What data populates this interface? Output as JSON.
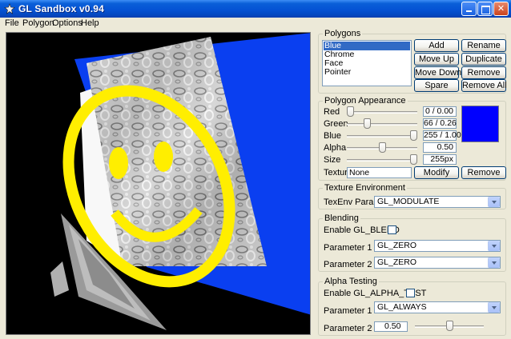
{
  "window": {
    "title": "GL Sandbox v0.94",
    "controls": {
      "minimize": "",
      "maximize": "",
      "close": "✕"
    }
  },
  "menu": [
    "File",
    "Polygon",
    "Options",
    "Help"
  ],
  "polygons": {
    "title": "Polygons",
    "items": [
      "Blue",
      "Chrome",
      "Face",
      "Pointer"
    ],
    "selected": "Blue",
    "buttons": {
      "add": "Add",
      "rename": "Rename",
      "move_up": "Move Up",
      "duplicate": "Duplicate",
      "move_down": "Move Down",
      "remove": "Remove",
      "spare": "Spare",
      "remove_all": "Remove All"
    }
  },
  "appearance": {
    "title": "Polygon Appearance",
    "red": {
      "label": "Red",
      "value": "0 / 0.00",
      "level": 0.0
    },
    "green": {
      "label": "Green",
      "value": "66 / 0.26",
      "level": 0.26
    },
    "blue": {
      "label": "Blue",
      "value": "255 / 1.00",
      "level": 1.0
    },
    "alpha": {
      "label": "Alpha",
      "value": "0.50",
      "level": 0.5
    },
    "size": {
      "label": "Size",
      "value": "255px",
      "level": 1.0
    },
    "swatch_color": "#0000ff",
    "texture": {
      "label": "Texture",
      "value": "None",
      "modify": "Modify",
      "remove": "Remove"
    }
  },
  "texenv": {
    "title": "Texture Environment",
    "param_label": "TexEnv Param",
    "param_value": "GL_MODULATE"
  },
  "blending": {
    "title": "Blending",
    "enable_label": "Enable GL_BLEND",
    "enabled": false,
    "param1_label": "Parameter 1",
    "param1_value": "GL_ZERO",
    "param2_label": "Parameter 2",
    "param2_value": "GL_ZERO"
  },
  "alpha_testing": {
    "title": "Alpha Testing",
    "enable_label": "Enable GL_ALPHA_TEST",
    "enabled": false,
    "param1_label": "Parameter 1",
    "param1_value": "GL_ALWAYS",
    "param2_label": "Parameter 2",
    "param2_value": "0.50",
    "param2_level": 0.5
  },
  "colors": {
    "titlebar": "#0553d4",
    "selection": "#316ac5",
    "blue_polygon": "#0a3ff0",
    "smiley_yellow": "#ffee00",
    "canvas_background": "#000000"
  }
}
